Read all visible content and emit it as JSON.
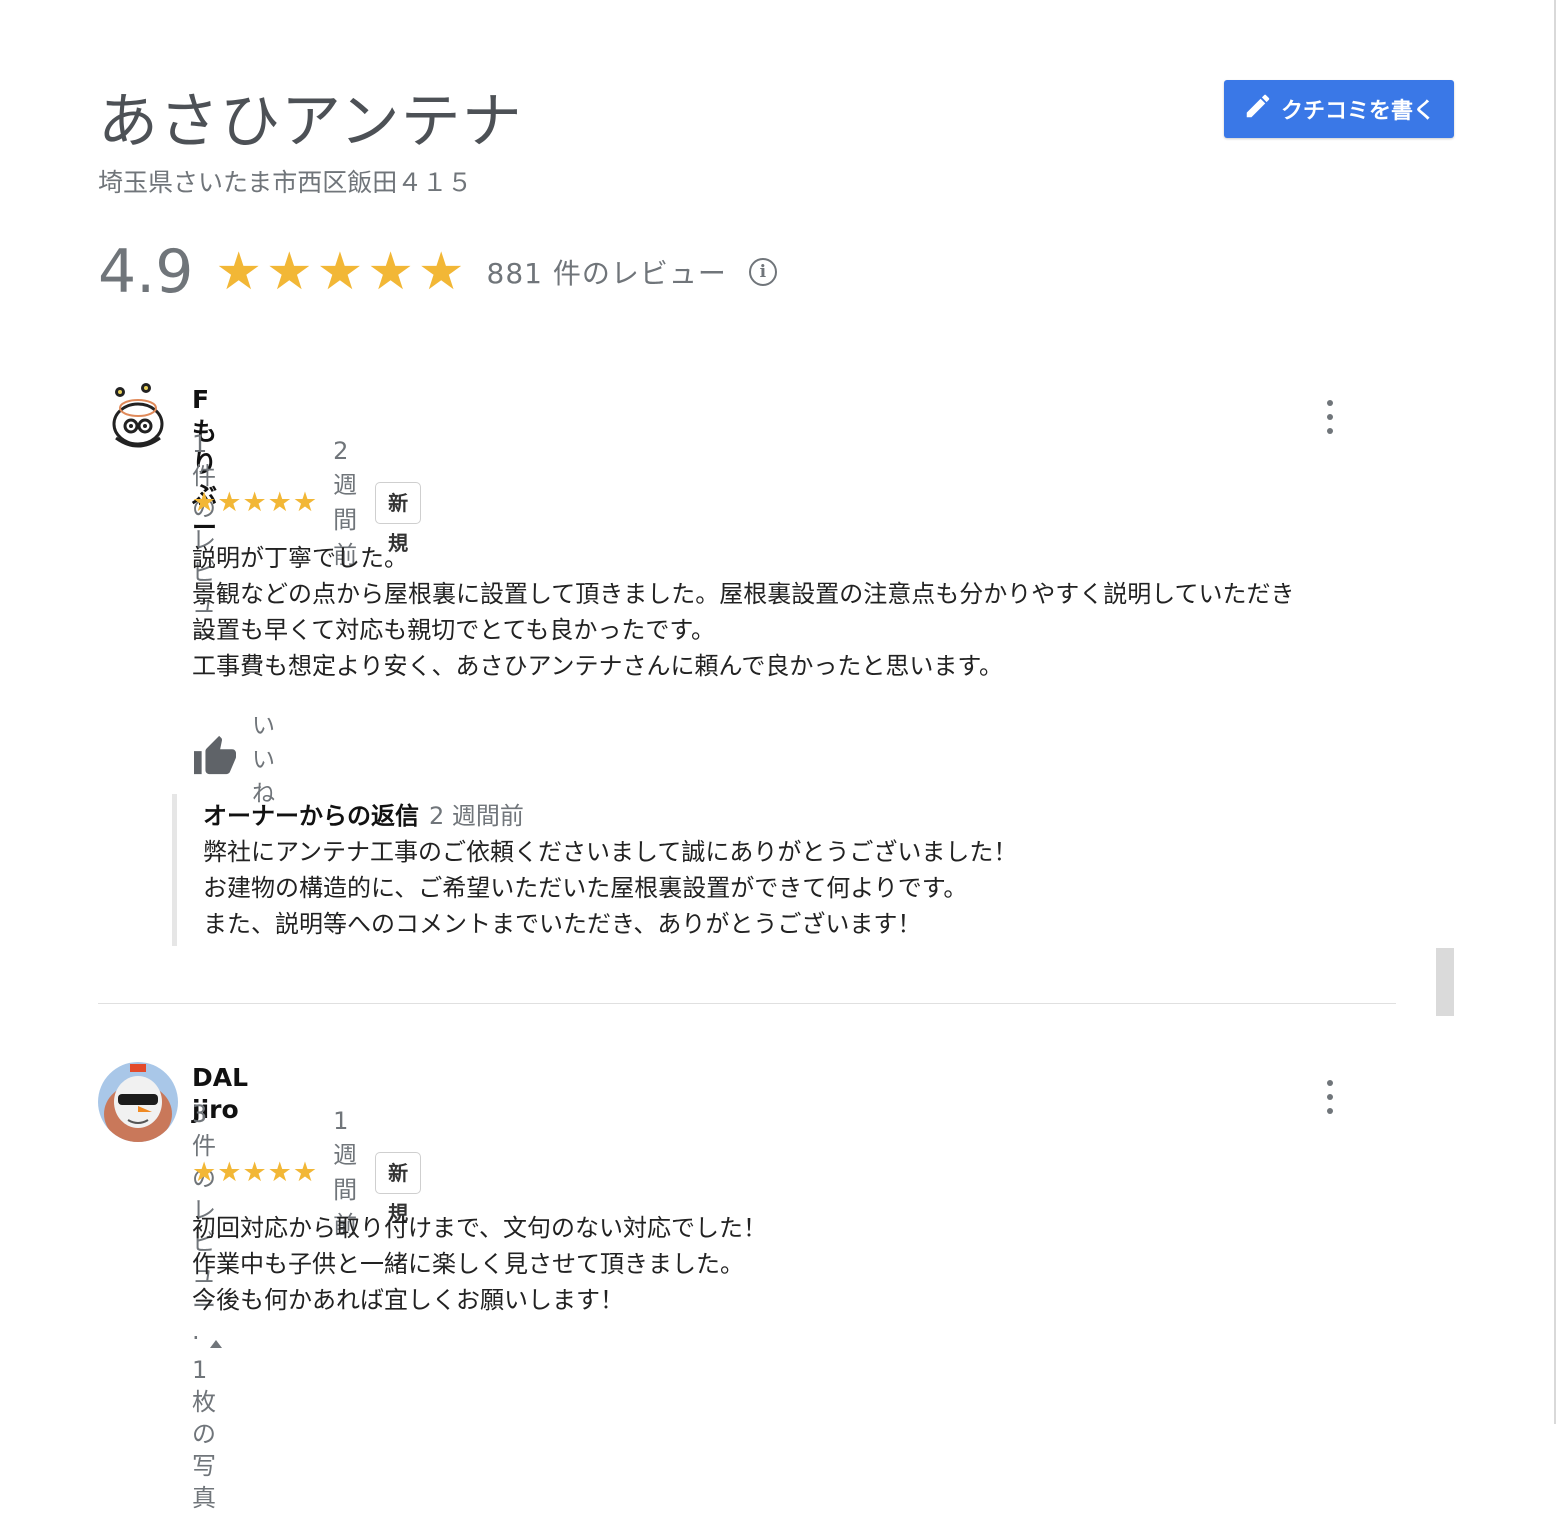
{
  "business": {
    "name": "あさひアンテナ",
    "address": "埼玉県さいたま市西区飯田４１５",
    "rating": "4.9",
    "stars_filled": 5,
    "review_count_label": "881 件のレビュー",
    "info_icon": "info-icon"
  },
  "write_review": {
    "label": "クチコミを書く",
    "icon": "pencil-icon"
  },
  "colors": {
    "star": "#f2b736",
    "button": "#3a78e7",
    "muted_text": "#70757a"
  },
  "reviews": [
    {
      "author": "Fもりぶー",
      "meta": "1 件のレビュー",
      "rating": 5,
      "time": "2 週間前",
      "badge": "新規",
      "lines": [
        "説明が丁寧でした。",
        "景観などの点から屋根裏に設置して頂きました。屋根裏設置の注意点も分かりやすく説明していただき",
        "設置も早くて対応も親切でとても良かったです。",
        "工事費も想定より安く、あさひアンテナさんに頼んで良かったと思います。"
      ],
      "like_label": "いいね",
      "owner_reply": {
        "title": "オーナーからの返信",
        "time": "2 週間前",
        "lines": [
          "弊社にアンテナ工事のご依頼くださいまして誠にありがとうございました！",
          "お建物の構造的に、ご希望いただいた屋根裏設置ができて何よりです。",
          "また、説明等へのコメントまでいただき、ありがとうございます！"
        ]
      }
    },
    {
      "author": "DAL jiro",
      "meta": "3 件のレビュー · 1 枚の写真",
      "rating": 5,
      "time": "1 週間前",
      "badge": "新規",
      "lines": [
        "初回対応から取り付けまで、文句のない対応でした！",
        "作業中も子供と一緒に楽しく見させて頂きました。",
        "今後も何かあれば宜しくお願いします！"
      ]
    }
  ]
}
